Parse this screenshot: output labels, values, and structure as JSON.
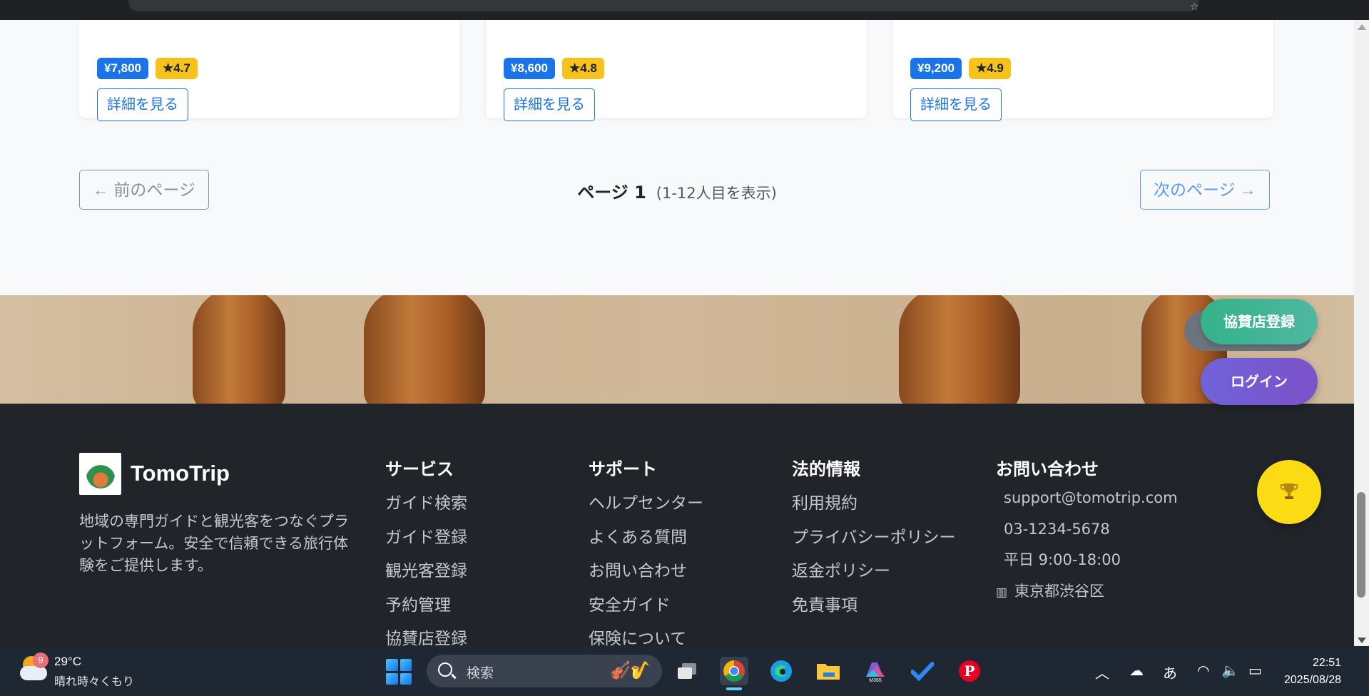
{
  "cards": [
    {
      "price": "¥7,800",
      "rating": "★4.7",
      "button": "詳細を見る"
    },
    {
      "price": "¥8,600",
      "rating": "★4.8",
      "button": "詳細を見る"
    },
    {
      "price": "¥9,200",
      "rating": "★4.9",
      "button": "詳細を見る"
    }
  ],
  "pagination": {
    "prev": "← 前のページ",
    "page": "ページ 1",
    "range": "(1-12人目を表示)",
    "next": "次のページ →"
  },
  "floating": {
    "sponsor": "協賛店登録",
    "login": "ログイン",
    "trophy_icon": "trophy-icon"
  },
  "footer": {
    "brand": "TomoTrip",
    "description": "地域の専門ガイドと観光客をつなぐプラットフォーム。安全で信頼できる旅行体験をご提供します。",
    "services": {
      "title": "サービス",
      "items": [
        "ガイド検索",
        "ガイド登録",
        "観光客登録",
        "予約管理",
        "協賛店登録"
      ]
    },
    "support": {
      "title": "サポート",
      "items": [
        "ヘルプセンター",
        "よくある質問",
        "お問い合わせ",
        "安全ガイド",
        "保険について"
      ]
    },
    "legal": {
      "title": "法的情報",
      "items": [
        "利用規約",
        "プライバシーポリシー",
        "返金ポリシー",
        "免責事項"
      ]
    },
    "contact": {
      "title": "お問い合わせ",
      "email": "support@tomotrip.com",
      "phone": "03-1234-5678",
      "hours": "平日 9:00-18:00",
      "address": "東京都渋谷区"
    }
  },
  "taskbar": {
    "weather_temp": "29°C",
    "weather_desc": "晴れ時々くもり",
    "weather_badge": "9",
    "search_label": "検索",
    "ime": "あ",
    "time": "22:51",
    "date": "2025/08/28"
  },
  "colors": {
    "price_badge": "#1a73e8",
    "rating_badge": "#f7c21b",
    "footer_bg": "#212529",
    "sponsor_button": "#34b38a",
    "login_button": "#6f63d8",
    "trophy_button": "#fadb14"
  }
}
